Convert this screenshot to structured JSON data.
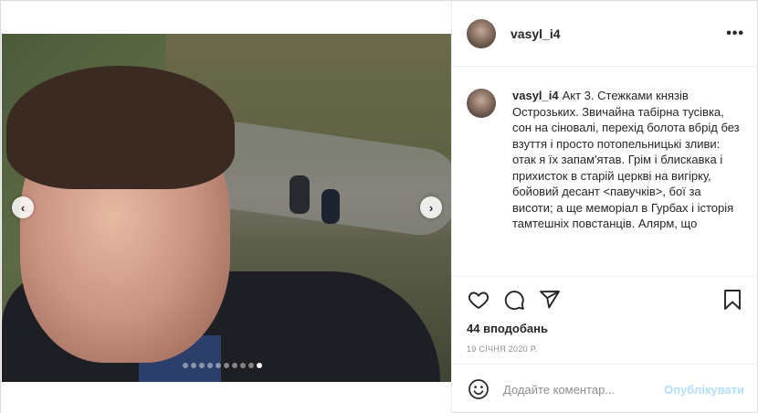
{
  "post": {
    "author": "vasyl_i4",
    "caption": "Акт 3. Стежками князів Острозьких. Звичайна табірна тусівка, сон на сіновалі, перехід болота вбрід без взуття і просто потопельницькі зливи: отак я їх запам'ятав. Грім і блискавка і прихисток в старій церкві на вигірку, бойовий десант <павучків>, бої за висоти; а ще меморіал в Гурбах і історія тамтешніх повстанців. Алярм, що",
    "likes": "44 вподобань",
    "date": "19 СІЧНЯ 2020 Р."
  },
  "media": {
    "prev_glyph": "‹",
    "next_glyph": "›",
    "slide_count": 10,
    "active_slide": 10
  },
  "header": {
    "more_label": "•••"
  },
  "comment_box": {
    "placeholder": "Додайте коментар...",
    "publish_label": "Опублікувати"
  },
  "icons": {
    "like": "heart-icon",
    "comment": "comment-icon",
    "share": "share-icon",
    "save": "bookmark-icon",
    "emoji": "emoji-icon"
  },
  "colors": {
    "publish_disabled": "#b2dffc",
    "muted": "#8e8e8e",
    "text": "#262626"
  }
}
